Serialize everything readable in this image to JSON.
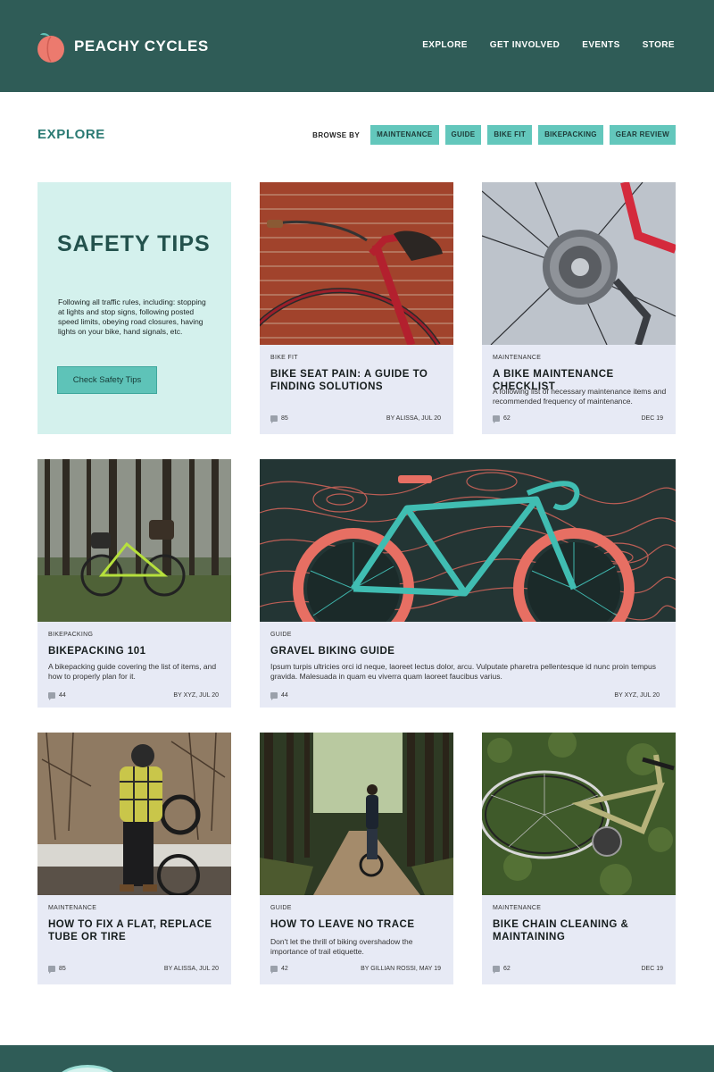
{
  "brand": {
    "name": "PEACHY CYCLES",
    "icon": "peach-icon",
    "peach_color": "#ec7a6e"
  },
  "nav": [
    "EXPLORE",
    "GET INVOLVED",
    "EVENTS",
    "STORE"
  ],
  "explore": {
    "title": "EXPLORE",
    "browse_label": "BROWSE BY",
    "filters": [
      "MAINTENANCE",
      "GUIDE",
      "BIKE FIT",
      "BIKEPACKING",
      "GEAR REVIEW"
    ]
  },
  "safety": {
    "title": "SAFETY TIPS",
    "text": "Following all traffic rules, including: stopping at lights and stop signs, following posted speed limits, obeying road closures, having lights on your bike, hand signals, etc.",
    "button": "Check Safety Tips"
  },
  "cards": [
    {
      "category": "BIKE FIT",
      "title": "BIKE SEAT PAIN: A GUIDE TO FINDING SOLUTIONS",
      "description": "",
      "comments": "85",
      "byline": "BY ALISSA, JUL 20",
      "image": "red-penny-farthing-brick-wall"
    },
    {
      "category": "MAINTENANCE",
      "title": "A BIKE MAINTENANCE CHECKLIST",
      "description": "A following list of necessary maintenance items and recommended frequency of maintenance.",
      "comments": "62",
      "byline": "DEC 19",
      "image": "rear-cassette-closeup"
    },
    {
      "category": "BIKEPACKING",
      "title": "BIKEPACKING 101",
      "description": "A bikepacking guide covering the list of items, and how to properly plan for it.",
      "comments": "44",
      "byline": "BY XYZ, JUL 20",
      "image": "loaded-bike-in-forest"
    },
    {
      "category": "GUIDE",
      "title": "GRAVEL BIKING GUIDE",
      "description": "Ipsum turpis ultricies orci id neque, laoreet lectus dolor, arcu. Vulputate pharetra pellentesque id nunc proin tempus gravida. Malesuada in quam eu viverra quam laoreet faucibus varius.",
      "comments": "44",
      "byline": "BY XYZ, JUL 20",
      "image": "gravel-bike-illustration"
    },
    {
      "category": "MAINTENANCE",
      "title": "HOW TO FIX A FLAT, REPLACE TUBE OR TIRE",
      "description": "",
      "comments": "85",
      "byline": "BY ALISSA, JUL 20",
      "image": "person-fixing-bike-tire"
    },
    {
      "category": "GUIDE",
      "title": "HOW TO LEAVE NO TRACE",
      "description": "Don't let the thrill of biking overshadow the importance of trail etiquette.",
      "comments": "42",
      "byline": "BY GILLIAN ROSSI, MAY 19",
      "image": "rider-on-forest-trail"
    },
    {
      "category": "MAINTENANCE",
      "title": "BIKE CHAIN CLEANING & MAINTAINING",
      "description": "",
      "comments": "62",
      "byline": "DEC 19",
      "image": "bike-lying-on-grass"
    }
  ],
  "colors": {
    "header": "#2f5c57",
    "accent": "#63c7bc",
    "card_bg": "#e7eaf5",
    "safety_bg": "#d4f1ed"
  }
}
